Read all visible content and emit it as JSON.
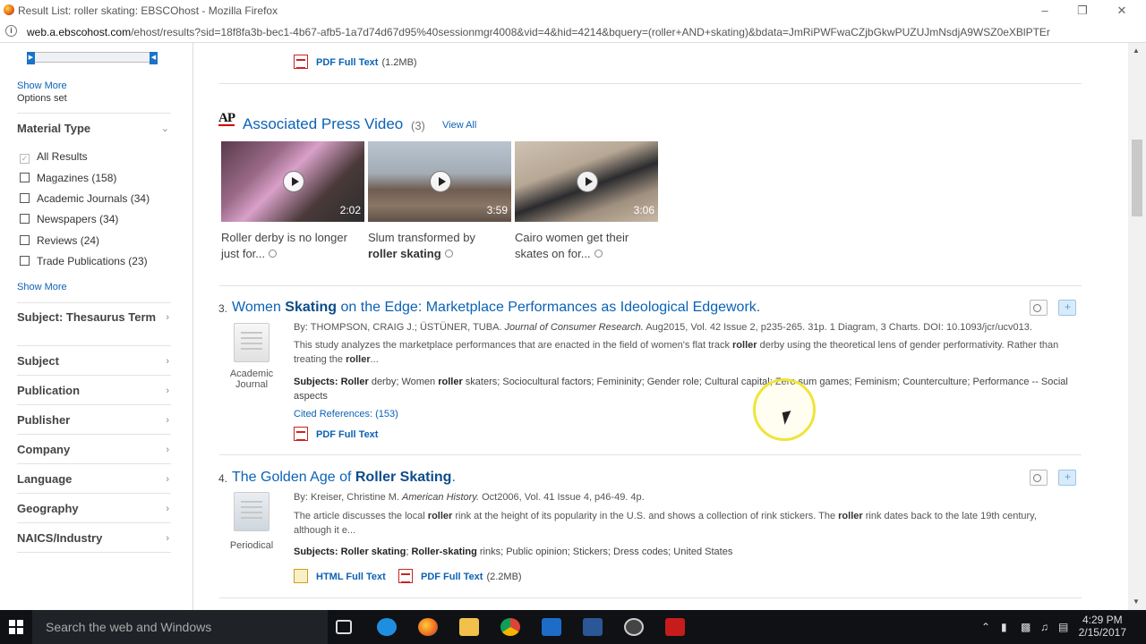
{
  "window": {
    "title": "Result List: roller skating: EBSCOhost - Mozilla Firefox"
  },
  "urlbar": {
    "host": "web.a.ebscohost.com",
    "rest": "/ehost/results?sid=18f8fa3b-bec1-4b67-afb5-1a7d74d67d95%40sessionmgr4008&vid=4&hid=4214&bquery=(roller+AND+skating)&bdata=JmRiPWFwaCZjbGkwPUZUJmNsdjA9WSZ0eXBlPTEr"
  },
  "sidebar": {
    "show_more_1": "Show More",
    "options_set": "Options set",
    "material_type": {
      "heading": "Material Type",
      "all_results": "All Results",
      "items": [
        {
          "label": "Magazines",
          "count": "(158)"
        },
        {
          "label": "Academic Journals",
          "count": "(34)"
        },
        {
          "label": "Newspapers",
          "count": "(34)"
        },
        {
          "label": "Reviews",
          "count": "(24)"
        },
        {
          "label": "Trade Publications",
          "count": "(23)"
        }
      ],
      "show_more": "Show More"
    },
    "facets": [
      "Subject: Thesaurus Term",
      "Subject",
      "Publication",
      "Publisher",
      "Company",
      "Language",
      "Geography",
      "NAICS/Industry"
    ]
  },
  "top_result": {
    "pdf_label": "PDF Full Text",
    "size": "(1.2MB)"
  },
  "ap_video": {
    "logo": "AP",
    "title": "Associated Press Video",
    "count": "(3)",
    "view_all": "View All",
    "videos": [
      {
        "duration": "2:02",
        "caption_a": "Roller derby is no longer just for...",
        "caption_b": ""
      },
      {
        "duration": "3:59",
        "caption_a": "Slum transformed by",
        "caption_b": "roller skating"
      },
      {
        "duration": "3:06",
        "caption_a": "Cairo women get their skates on for...",
        "caption_b": ""
      }
    ]
  },
  "results": [
    {
      "num": "3.",
      "title_a": "Women ",
      "title_b": "Skating",
      "title_c": " on the Edge: Marketplace Performances as Ideological Edgework.",
      "meta_a": "By: THOMPSON, CRAIG J.; ÜSTÜNER, TUBA. ",
      "meta_journal": "Journal of Consumer Research.",
      "meta_b": " Aug2015, Vol. 42 Issue 2, p235-265. 31p. 1 Diagram, 3 Charts. DOI: 10.1093/jcr/ucv013.",
      "abstract_a": "This study analyzes the marketplace performances that are enacted in the field of women's flat track ",
      "abstract_b": "roller",
      "abstract_c": " derby using the theoretical lens of gender performativity. Rather than treating the ",
      "abstract_d": "roller",
      "abstract_e": "...",
      "subjects_label": "Subjects:",
      "subjects_a": "Roller",
      "subjects_b": " derby; Women ",
      "subjects_c": "roller",
      "subjects_d": " skaters; Sociocultural factors; Femininity; Gender role; Cultural capital; Zero sum games; Feminism; Counterculture; Performance -- Social aspects",
      "cited": "Cited References: (153)",
      "doc_type": "Academic Journal",
      "pdf_label": "PDF Full Text"
    },
    {
      "num": "4.",
      "title_a": "The Golden Age of ",
      "title_b": "Roller Skating",
      "title_c": ".",
      "meta_a": "By: Kreiser, Christine M. ",
      "meta_journal": "American History.",
      "meta_b": " Oct2006, Vol. 41 Issue 4, p46-49. 4p.",
      "abstract_a": "The article discusses the local ",
      "abstract_b": "roller",
      "abstract_c": " rink at the height of its popularity in the U.S. and shows a collection of rink stickers. The ",
      "abstract_d": "roller",
      "abstract_e": " rink dates back to the late 19th century, although it e...",
      "subjects_label": "Subjects:",
      "subjects_a": "Roller skating",
      "subjects_b": "; ",
      "subjects_c": "Roller-skating",
      "subjects_d": " rinks; Public opinion; Stickers; Dress codes; United States",
      "doc_type": "Periodical",
      "html_label": "HTML Full Text",
      "pdf_label": "PDF Full Text",
      "pdf_size": "(2.2MB)"
    }
  ],
  "taskbar": {
    "search_placeholder": "Search the web and Windows",
    "time": "4:29 PM",
    "date": "2/15/2017"
  },
  "icons": {
    "close": "close-icon",
    "restore": "restore-icon",
    "minimize": "minimize-icon"
  }
}
